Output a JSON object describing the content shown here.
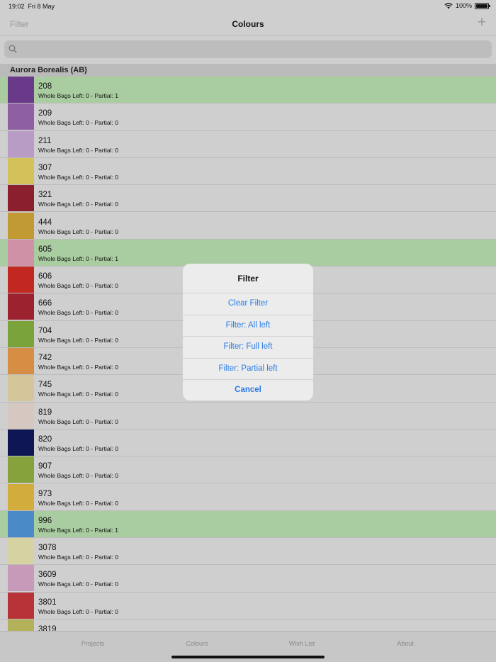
{
  "status_bar": {
    "time": "19:02",
    "date": "Fri 8 May",
    "battery": "100%",
    "battery_fraction": 1.0
  },
  "nav": {
    "filter_label": "Filter",
    "title": "Colours",
    "add_label": "+"
  },
  "search": {
    "placeholder": ""
  },
  "section": {
    "title": "Aurora Borealis (AB)"
  },
  "rows": [
    {
      "code": "208",
      "info": "Whole Bags Left: 0 - Partial: 1",
      "color": "#6a3a8a",
      "highlight": true
    },
    {
      "code": "209",
      "info": "Whole Bags Left: 0 - Partial: 0",
      "color": "#8e5fa2",
      "highlight": false
    },
    {
      "code": "211",
      "info": "Whole Bags Left: 0 - Partial: 0",
      "color": "#b89cc6",
      "highlight": false
    },
    {
      "code": "307",
      "info": "Whole Bags Left: 0 - Partial: 0",
      "color": "#d3c25a",
      "highlight": false
    },
    {
      "code": "321",
      "info": "Whole Bags Left: 0 - Partial: 0",
      "color": "#8c1f2e",
      "highlight": false
    },
    {
      "code": "444",
      "info": "Whole Bags Left: 0 - Partial: 0",
      "color": "#c29a34",
      "highlight": false
    },
    {
      "code": "605",
      "info": "Whole Bags Left: 0 - Partial: 1",
      "color": "#cf91a5",
      "highlight": true
    },
    {
      "code": "606",
      "info": "Whole Bags Left: 0 - Partial: 0",
      "color": "#c12821",
      "highlight": false
    },
    {
      "code": "666",
      "info": "Whole Bags Left: 0 - Partial: 0",
      "color": "#9c2230",
      "highlight": false
    },
    {
      "code": "704",
      "info": "Whole Bags Left: 0 - Partial: 0",
      "color": "#7aa33c",
      "highlight": false
    },
    {
      "code": "742",
      "info": "Whole Bags Left: 0 - Partial: 0",
      "color": "#d58e43",
      "highlight": false
    },
    {
      "code": "745",
      "info": "Whole Bags Left: 0 - Partial: 0",
      "color": "#d4c69a",
      "highlight": false
    },
    {
      "code": "819",
      "info": "Whole Bags Left: 0 - Partial: 0",
      "color": "#d5c8c0",
      "highlight": false
    },
    {
      "code": "820",
      "info": "Whole Bags Left: 0 - Partial: 0",
      "color": "#0f1654",
      "highlight": false
    },
    {
      "code": "907",
      "info": "Whole Bags Left: 0 - Partial: 0",
      "color": "#86a23c",
      "highlight": false
    },
    {
      "code": "973",
      "info": "Whole Bags Left: 0 - Partial: 0",
      "color": "#d2ad3c",
      "highlight": false
    },
    {
      "code": "996",
      "info": "Whole Bags Left: 0 - Partial: 1",
      "color": "#4a8ac6",
      "highlight": true
    },
    {
      "code": "3078",
      "info": "Whole Bags Left: 0 - Partial: 0",
      "color": "#d7d2a2",
      "highlight": false
    },
    {
      "code": "3609",
      "info": "Whole Bags Left: 0 - Partial: 0",
      "color": "#c79aba",
      "highlight": false
    },
    {
      "code": "3801",
      "info": "Whole Bags Left: 0 - Partial: 0",
      "color": "#b83338",
      "highlight": false
    },
    {
      "code": "3819",
      "info": "",
      "color": "#b3b25a",
      "highlight": false
    }
  ],
  "tabs": [
    {
      "label": "Projects"
    },
    {
      "label": "Colours"
    },
    {
      "label": "Wish List"
    },
    {
      "label": "About"
    }
  ],
  "alert": {
    "title": "Filter",
    "actions": [
      {
        "label": "Clear Filter"
      },
      {
        "label": "Filter: All left"
      },
      {
        "label": "Filter: Full left"
      },
      {
        "label": "Filter: Partial left"
      },
      {
        "label": "Cancel"
      }
    ]
  }
}
